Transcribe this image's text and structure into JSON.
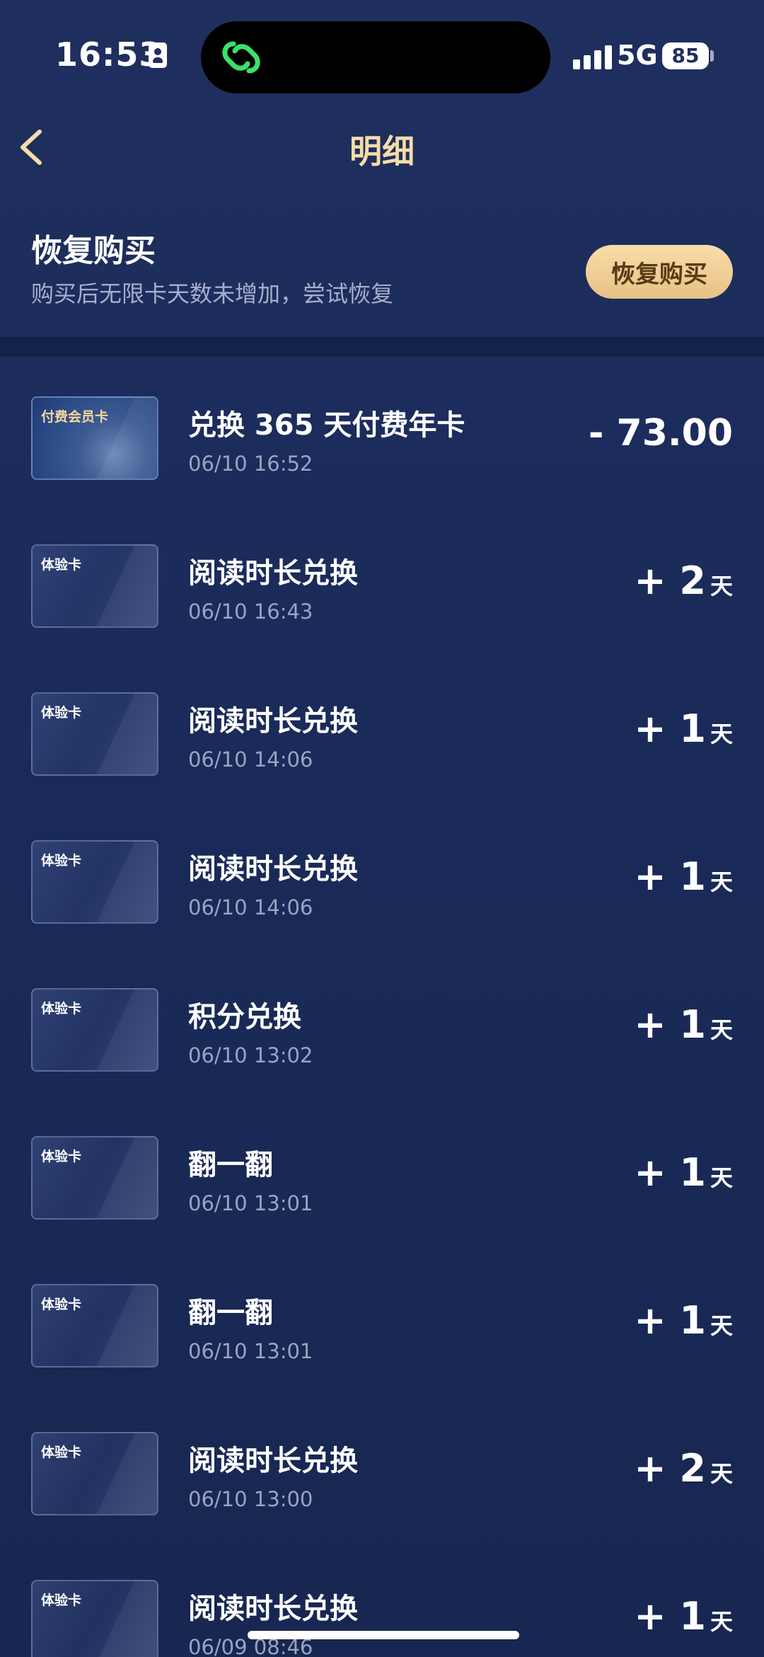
{
  "status_bar": {
    "time": "16:53",
    "network": "5G",
    "battery": "85"
  },
  "nav": {
    "title": "明细"
  },
  "restore": {
    "title": "恢复购买",
    "description": "购买后无限卡天数未增加，尝试恢复",
    "button_label": "恢复购买"
  },
  "records": [
    {
      "card_label": "付费会员卡",
      "card_type": "paid",
      "title": "兑换 365 天付费年卡",
      "time": "06/10 16:52",
      "amount": "- 73.00"
    },
    {
      "card_label": "体验卡",
      "card_type": "trial",
      "title": "阅读时长兑换",
      "time": "06/10 16:43",
      "value": "+ 2",
      "unit": "天"
    },
    {
      "card_label": "体验卡",
      "card_type": "trial",
      "title": "阅读时长兑换",
      "time": "06/10 14:06",
      "value": "+ 1",
      "unit": "天"
    },
    {
      "card_label": "体验卡",
      "card_type": "trial",
      "title": "阅读时长兑换",
      "time": "06/10 14:06",
      "value": "+ 1",
      "unit": "天"
    },
    {
      "card_label": "体验卡",
      "card_type": "trial",
      "title": "积分兑换",
      "time": "06/10 13:02",
      "value": "+ 1",
      "unit": "天"
    },
    {
      "card_label": "体验卡",
      "card_type": "trial",
      "title": "翻一翻",
      "time": "06/10 13:01",
      "value": "+ 1",
      "unit": "天"
    },
    {
      "card_label": "体验卡",
      "card_type": "trial",
      "title": "翻一翻",
      "time": "06/10 13:01",
      "value": "+ 1",
      "unit": "天"
    },
    {
      "card_label": "体验卡",
      "card_type": "trial",
      "title": "阅读时长兑换",
      "time": "06/10 13:00",
      "value": "+ 2",
      "unit": "天"
    },
    {
      "card_label": "体验卡",
      "card_type": "trial",
      "title": "阅读时长兑换",
      "time": "06/09 08:46",
      "value": "+ 1",
      "unit": "天"
    }
  ],
  "colors": {
    "accent_gold": "#f6dca8",
    "button_gold": "#eccb8e",
    "background": "#1b2b5b"
  }
}
